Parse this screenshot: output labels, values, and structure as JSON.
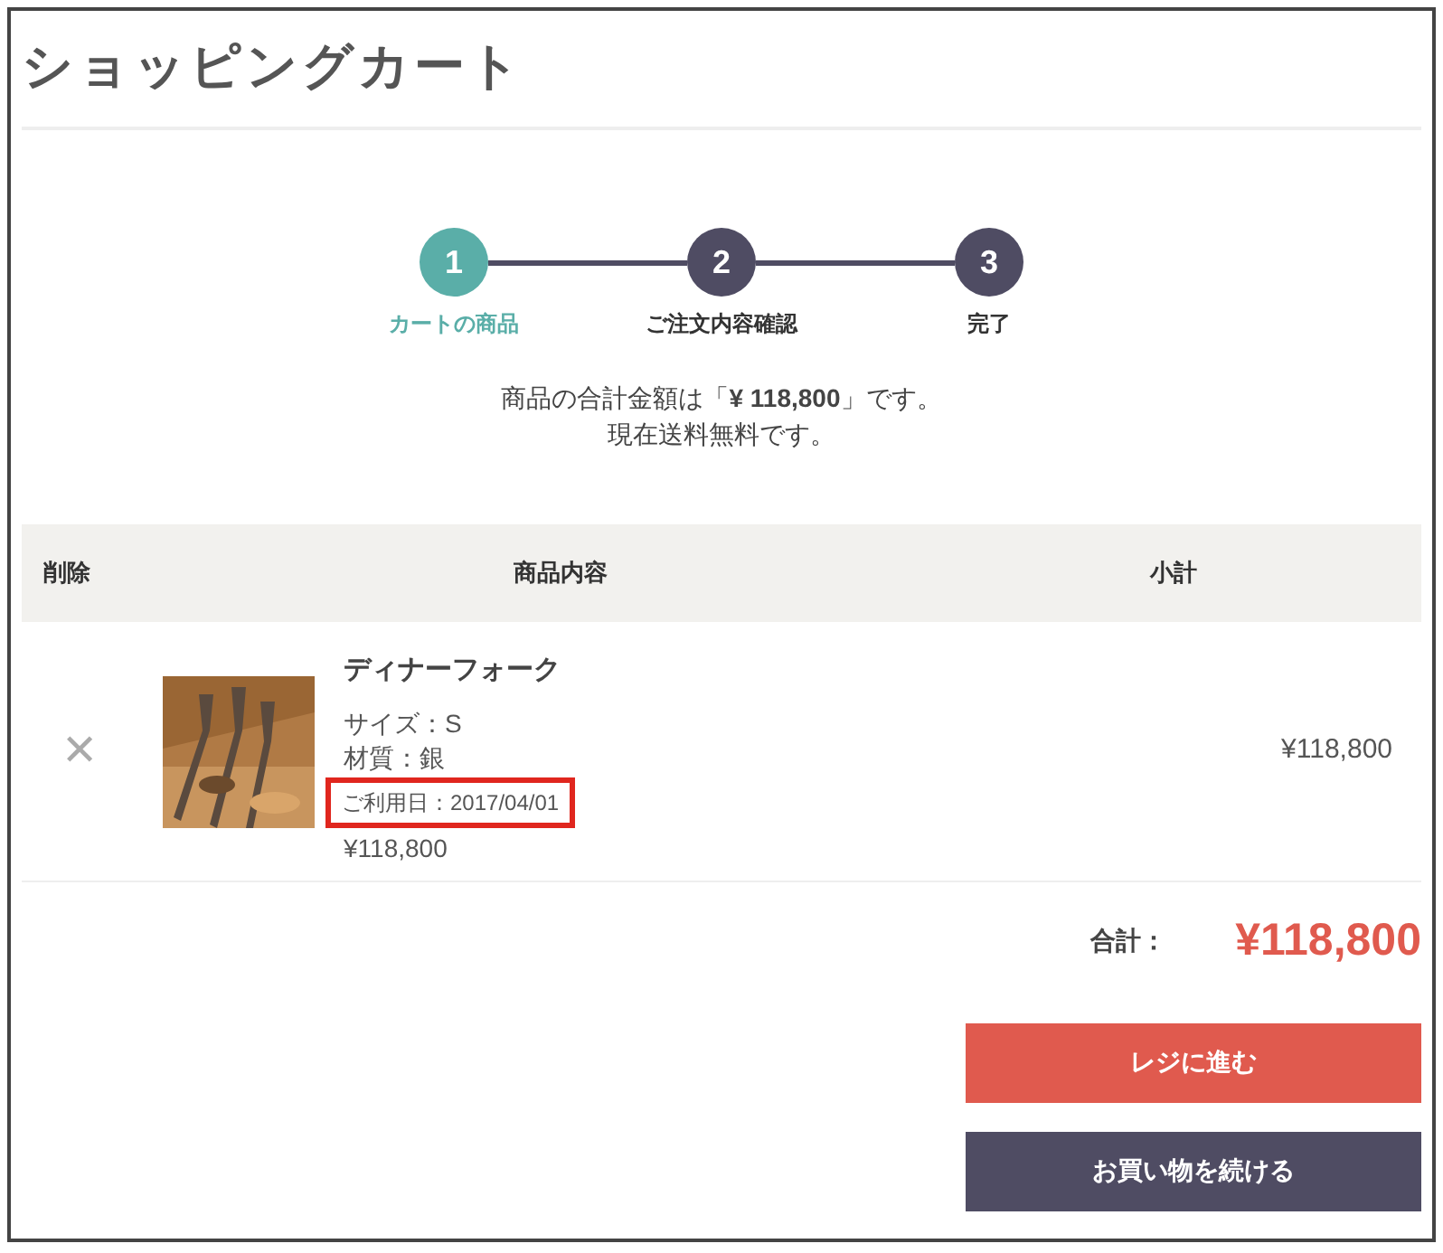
{
  "title": "ショッピングカート",
  "steps": [
    {
      "number": "1",
      "label": "カートの商品",
      "selected": true
    },
    {
      "number": "2",
      "label": "ご注文内容確認",
      "selected": false
    },
    {
      "number": "3",
      "label": "完了",
      "selected": false
    }
  ],
  "summary": [
    "商品の合計金額は「**¥ 118,800**」です。",
    "現在送料無料です。"
  ],
  "table": {
    "columns": [
      "削除",
      "商品内容",
      "小計"
    ],
    "rows": [
      {
        "remove": "✕",
        "name": "ディナーフォーク",
        "details": [
          {
            "text": "サイズ：S",
            "highlighted": false
          },
          {
            "text": "材質：銀",
            "highlighted": false
          },
          {
            "text": "ご利用日：2017/04/01",
            "highlighted": true
          }
        ],
        "price": "¥118,800",
        "subtotal": "¥118,800"
      }
    ]
  },
  "total": {
    "label": "合計：",
    "value": "¥118,800"
  },
  "buttons": [
    {
      "label": "レジに進む",
      "kind": "primary"
    },
    {
      "label": "お買い物を続ける",
      "kind": "secondary"
    }
  ]
}
